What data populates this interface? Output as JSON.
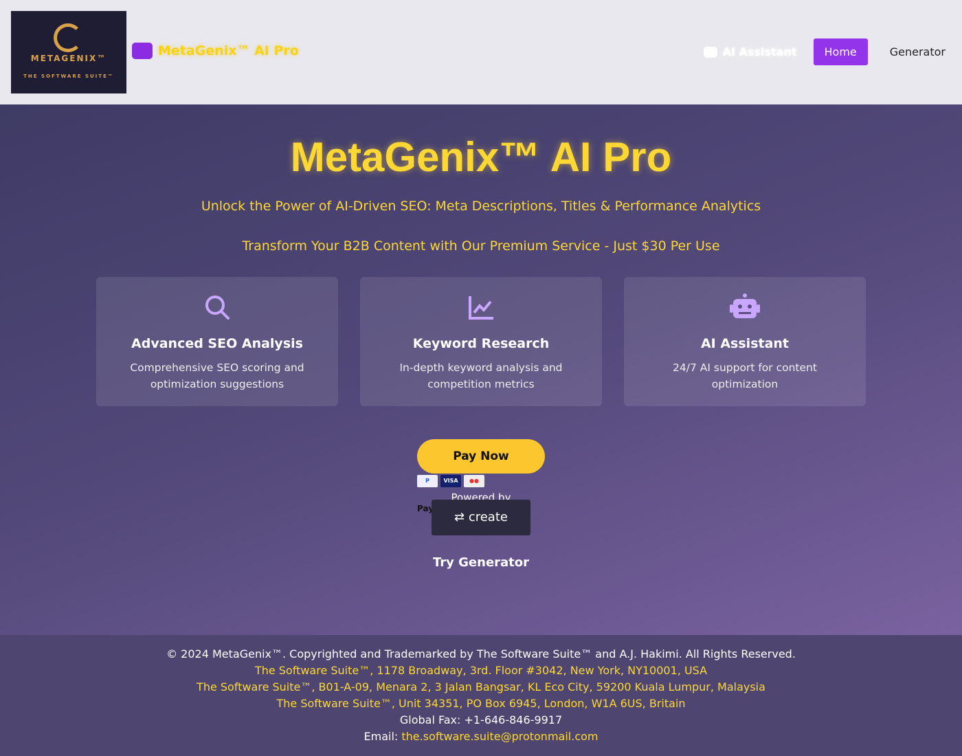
{
  "header": {
    "logo_text": "METAGENIX™",
    "logo_sub": "THE SOFTWARE SUITE™",
    "brand": "MetaGenix™ AI Pro",
    "nav": {
      "ai": "AI Assistant",
      "home": "Home",
      "generator": "Generator"
    }
  },
  "hero": {
    "title": "MetaGenix™ AI Pro",
    "subtitle": "Unlock the Power of AI-Driven SEO: Meta Descriptions, Titles & Performance Analytics",
    "tagline": "Transform Your B2B Content with Our Premium Service - Just $30 Per Use"
  },
  "features": [
    {
      "icon": "search-icon",
      "title": "Advanced SEO Analysis",
      "desc": "Comprehensive SEO scoring and optimization suggestions"
    },
    {
      "icon": "chart-line-icon",
      "title": "Keyword Research",
      "desc": "In-depth keyword analysis and competition metrics"
    },
    {
      "icon": "robot-icon",
      "title": "AI Assistant",
      "desc": "24/7 AI support for content optimization"
    }
  ],
  "payment": {
    "pay_now": "Pay Now",
    "paypal": "P",
    "visa": "VISA",
    "powered_by": "Powered by",
    "pay": "Pay",
    "create": "create",
    "try_generator": "Try Generator"
  },
  "footer": {
    "copyright": "© 2024 MetaGenix™. Copyrighted and Trademarked by The Software Suite™ and A.J. Hakimi. All Rights Reserved.",
    "addresses": [
      "The Software Suite™, 1178 Broadway, 3rd. Floor #3042, New York, NY10001, USA",
      "The Software Suite™, B01-A-09, Menara 2, 3 Jalan Bangsar, KL Eco City, 59200 Kuala Lumpur, Malaysia",
      "The Software Suite™, Unit 34351, PO Box 6945, London, W1A 6US, Britain"
    ],
    "fax": "Global Fax: +1-646-846-9917",
    "email_label": "Email:",
    "email": "the.software.suite@protonmail.com"
  },
  "colors": {
    "accent": "#9333ea",
    "yellow": "#fdd835"
  }
}
